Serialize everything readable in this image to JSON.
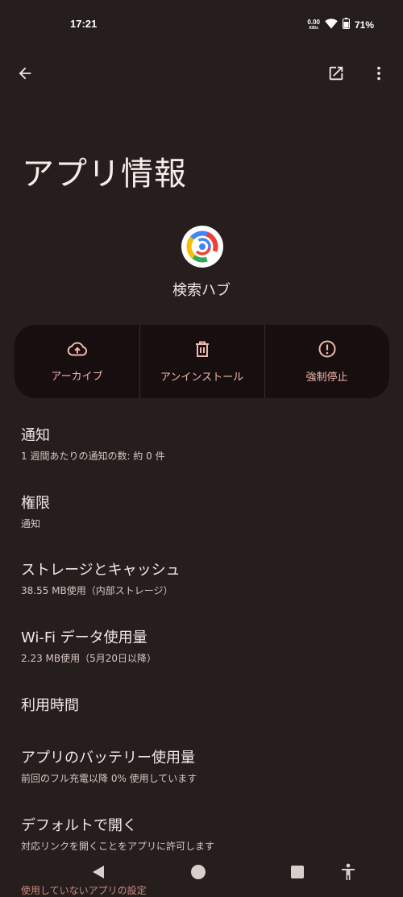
{
  "status_bar": {
    "time": "17:21",
    "net_speed_value": "0.00",
    "net_speed_unit": "KB/s",
    "battery_percent": "71%"
  },
  "header": {
    "title": "アプリ情報",
    "icons": {
      "back": "arrow-back-icon",
      "open": "open-in-new-icon",
      "more": "more-vert-icon"
    }
  },
  "app": {
    "name": "検索ハブ",
    "icon": "search-hub-app-icon"
  },
  "actions": [
    {
      "label": "アーカイブ",
      "icon": "cloud-upload-icon"
    },
    {
      "label": "アンインストール",
      "icon": "trash-icon"
    },
    {
      "label": "強制停止",
      "icon": "alert-circle-icon"
    }
  ],
  "settings": [
    {
      "title": "通知",
      "subtitle": "1 週間あたりの通知の数: 約 0 件"
    },
    {
      "title": "権限",
      "subtitle": "通知"
    },
    {
      "title": "ストレージとキャッシュ",
      "subtitle": "38.55 MB使用（内部ストレージ）"
    },
    {
      "title": "Wi-Fi データ使用量",
      "subtitle": "2.23 MB使用（5月20日以降）"
    },
    {
      "title": "利用時間",
      "subtitle": ""
    },
    {
      "title": "アプリのバッテリー使用量",
      "subtitle": "前回のフル充電以降 0% 使用しています"
    },
    {
      "title": "デフォルトで開く",
      "subtitle": "対応リンクを開くことをアプリに許可します"
    }
  ],
  "partial_item": "使用していないアプリの設定",
  "colors": {
    "background": "#261d1d",
    "card": "#170f0f",
    "accent": "#f4b7ac"
  }
}
